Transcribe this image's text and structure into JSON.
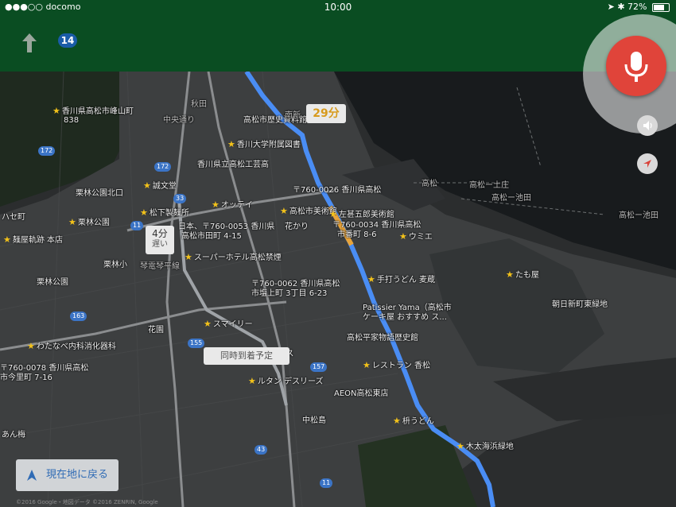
{
  "status_bar": {
    "carrier": "●●●○○ docomo",
    "time": "10:00",
    "battery": "72%",
    "battery_level": 0.72
  },
  "nav": {
    "road_number": "14"
  },
  "route_callouts": {
    "main_time": "29分",
    "alt_time": "4分",
    "alt_note": "遅い",
    "eta_note": "同時到着予定"
  },
  "map_labels": {
    "kagawa_mine": "香川県高松市峰山町",
    "kagawa_mine_sub": "838",
    "akita": "秋田",
    "chuo_dori": "中央通り",
    "rekishi": "高松市歴史資料館",
    "sayaka": "南新",
    "kagawa_univ": "香川大学附属図書",
    "kagawa_high": "香川県立高松工芸高",
    "kurinbayashi_north": "栗林公園北口",
    "tanaka": "誠文堂",
    "matsushita": "松下製麺所",
    "ottei": "オッテイ",
    "address_0026": "〒760-0026 香川県高松",
    "bijutsukan": "高松市美術館",
    "sazaburo": "左甚五郎美術館",
    "address_0034": "〒760-0034 香川県高松",
    "address_0034_sub": "市番町 8-6",
    "address_0053": "日本、〒760-0053 香川県",
    "address_0053_sub": "高松市田町 4-15",
    "hanakari": "花かり",
    "umie": "ウミエ",
    "kurinbayashi_park": "栗林公園",
    "haseta": "ハセ町",
    "kurinbayashi_sh": "栗林小",
    "menshoku": "麺屋軌跡 本店",
    "super_hotel": "スーパーホテル高松禁煙",
    "kotoden": "琴電琴平線",
    "kurinbayashi_st": "栗林公園",
    "teuchi": "手打うどん 麦蔵",
    "tamaya": "たも屋",
    "address_0062": "〒760-0062 香川県高松",
    "address_0062_sub": "市塩上町 3丁目 6-23",
    "patissier": "Patissier Yama（高松市",
    "patissier_sub": "ケーキ屋 おすすめ ス...",
    "asahi": "朝日新町東緑地",
    "smily": "スマイリー",
    "hanazono": "花園",
    "heike": "高松平家物語歴史館",
    "watanabe": "わたなべ内科消化器科",
    "address_0078": "〒760-0078 香川県高松",
    "address_0078_sub": "市今里町 7-16",
    "restaurant": "レストラン 香松",
    "ansu": "アンス",
    "rutan": "ルタン デスリーズ",
    "aeon": "AEON高松東店",
    "nakamatsujima": "中松島",
    "masu_udon": "枡うどん",
    "kitahama": "木太海浜緑地",
    "anbai": "あん梅",
    "takamatsu_tosa": "高松ー土庄",
    "takamatsu_ikeda": "高松ー池田",
    "takamatsu_ikeda_2": "高松ー池田",
    "sea_route": "高松",
    "shield_172": "172",
    "shield_172b": "172",
    "shield_33": "33",
    "shield_11": "11",
    "shield_163": "163",
    "shield_155": "155",
    "shield_157": "157",
    "shield_43": "43",
    "shield_11b": "11"
  },
  "controls": {
    "recenter_label": "現在地に戻る",
    "mic_icon": "microphone-icon",
    "sound_icon": "speaker-icon",
    "compass_icon": "compass-icon"
  },
  "copyright": "©2016 Google・地図データ ©2016 ZENRIN, Google"
}
